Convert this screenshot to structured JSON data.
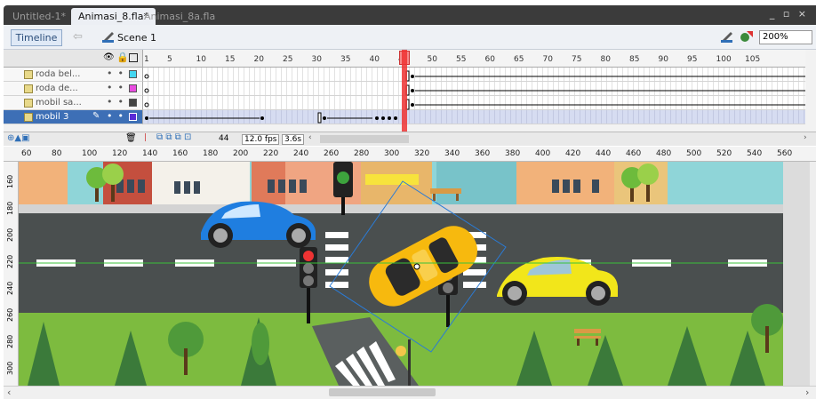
{
  "tabs": [
    {
      "label": "Untitled-1*"
    },
    {
      "label": "Animasi_8.fla*"
    },
    {
      "label": "Animasi_8a.fla"
    }
  ],
  "window_controls": "_ ▫ ×",
  "editbar": {
    "timeline_label": "Timeline",
    "scene_label": "Scene 1",
    "zoom_value": "200%"
  },
  "timeline": {
    "ruler_ticks": [
      "1",
      "5",
      "10",
      "15",
      "20",
      "25",
      "30",
      "35",
      "40",
      "45",
      "50",
      "55",
      "60",
      "65",
      "70",
      "75",
      "80",
      "85",
      "90",
      "95",
      "100",
      "105"
    ],
    "layers": [
      {
        "name": "roda bel...",
        "color": "#44d6f0"
      },
      {
        "name": "roda de...",
        "color": "#e84ce0"
      },
      {
        "name": "mobil sa...",
        "color": "#444444"
      },
      {
        "name": "mobil 3",
        "color": "#5a2bd6"
      }
    ],
    "current_frame": "44",
    "fps": "12.0 fps",
    "time": "3.6s",
    "playhead_frame": 44
  },
  "stage": {
    "h_ruler_ticks": [
      "60",
      "80",
      "100",
      "120",
      "140",
      "160",
      "180",
      "200",
      "220",
      "240",
      "260",
      "280",
      "300",
      "320",
      "340",
      "360",
      "380",
      "400",
      "420",
      "440",
      "460",
      "480",
      "500",
      "520",
      "540",
      "560"
    ],
    "v_ruler_ticks": [
      "160",
      "180",
      "200",
      "220",
      "240",
      "260",
      "280",
      "300"
    ]
  },
  "colors": {
    "sky": "#8fd5d8",
    "road": "#4a4f4f",
    "grass": "#7dbb3f",
    "car_blue": "#1f7ee0",
    "car_yellow": "#f2e61a",
    "car_orange": "#f7b90e",
    "selection": "#2a7bd6"
  }
}
